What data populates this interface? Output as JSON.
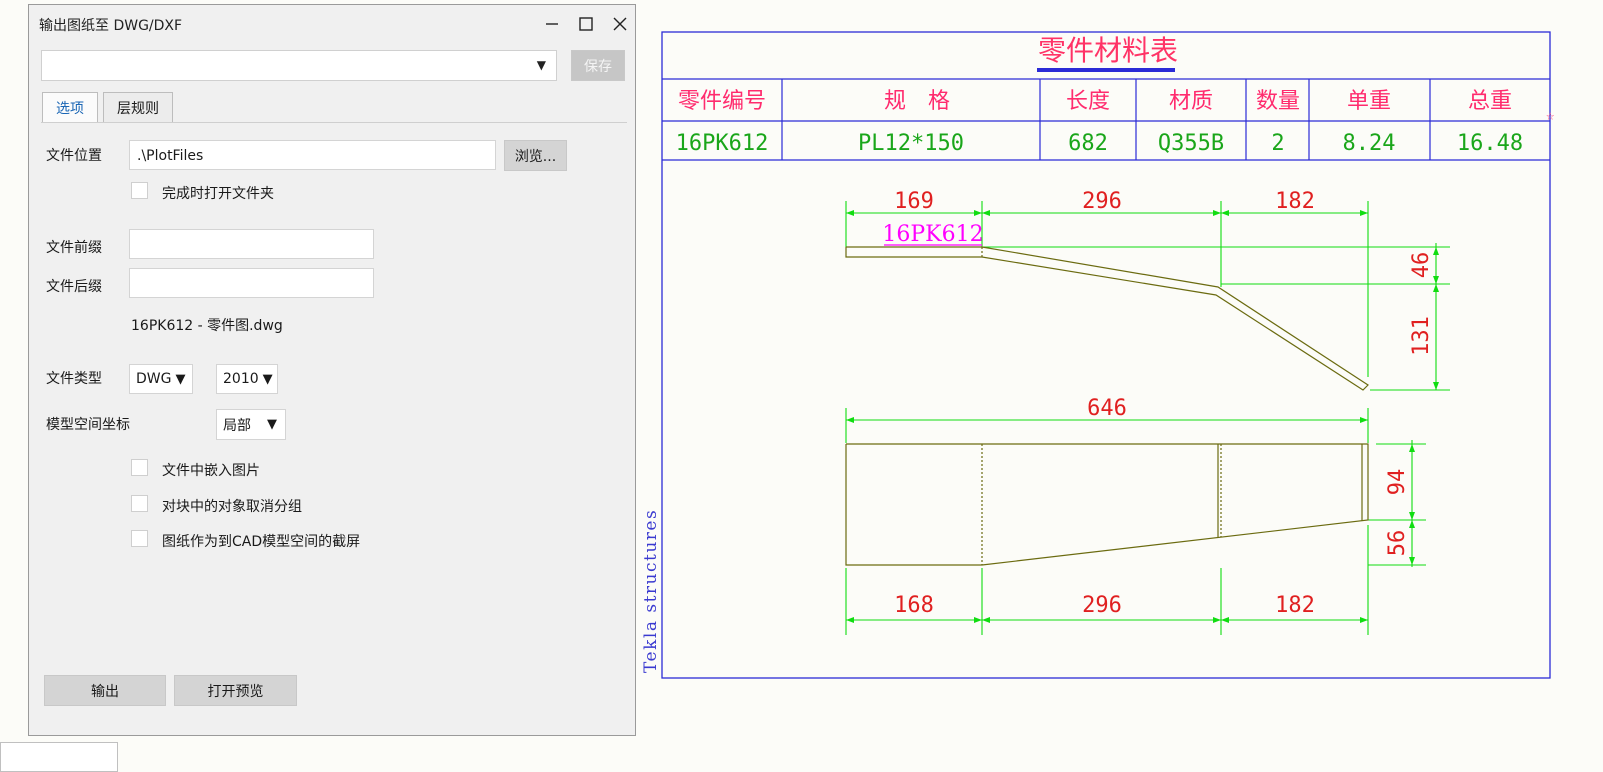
{
  "dialog": {
    "title": "输出图纸至 DWG/DXF",
    "minimize_icon": "minimize-icon",
    "maximize_icon": "maximize-icon",
    "close_icon": "close-icon",
    "settings_combo_value": "",
    "save_label": "保存",
    "tabs": [
      {
        "label": "选项",
        "active": true
      },
      {
        "label": "层规则",
        "active": false
      }
    ],
    "file_location_label": "文件位置",
    "file_location_value": ".\\PlotFiles",
    "browse_label": "浏览...",
    "open_folder_label": "完成时打开文件夹",
    "prefix_label": "文件前缀",
    "prefix_value": "",
    "suffix_label": "文件后缀",
    "suffix_value": "",
    "filename_preview": "16PK612 - 零件图.dwg",
    "file_type_label": "文件类型",
    "file_type_value": "DWG",
    "version_value": "2010",
    "model_coord_label": "模型空间坐标",
    "model_coord_value": "局部",
    "embed_images_label": "文件中嵌入图片",
    "ungroup_label": "对块中的对象取消分组",
    "screenshot_label": "图纸作为到CAD模型空间的截屏",
    "export_label": "输出",
    "preview_label": "打开预览"
  },
  "drawing": {
    "table_title": "零件材料表",
    "headers": [
      "零件编号",
      "规　格",
      "长度",
      "材质",
      "数量",
      "单重",
      "总重"
    ],
    "row": [
      "16PK612",
      "PL12*150",
      "682",
      "Q355B",
      "2",
      "8.24",
      "16.48"
    ],
    "side_text": "Tekla structures",
    "part_label": "16PK612",
    "dims_top": [
      "169",
      "296",
      "182"
    ],
    "dims_right_top": [
      "46",
      "131"
    ],
    "dim_overall": "646",
    "dims_right_bottom": [
      "94",
      "56"
    ],
    "dims_bottom": [
      "168",
      "296",
      "182"
    ],
    "colors": {
      "frame": "#2b2bd6",
      "header_text": "#ff2b6e",
      "row_text": "#1aa61a",
      "dim_text": "#e02020",
      "dim_line": "#11dd11",
      "part_line": "#6b6b10",
      "part_label": "#ff00ff",
      "title_text": "#ff3366"
    }
  }
}
